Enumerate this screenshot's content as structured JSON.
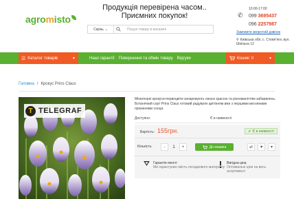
{
  "header": {
    "logo": {
      "part1": "agro",
      "part2": "m",
      "part3": "isto"
    },
    "slogan_line1": "Продукція перевірена часом..",
    "slogan_line2": "Приємних покупок!",
    "search": {
      "scope": "Скрізь",
      "placeholder": "Пошук товару в магазині"
    },
    "contacts": {
      "hours": "10:00-17:00",
      "phone1_prefix": "099",
      "phone1_number": "3695437",
      "phone2_prefix": "096",
      "phone2_number": "2257987",
      "callback": "Замовити зворотній дзвінок",
      "address_line1": "Київська обл, с. Стовпʼяги, вул.",
      "address_line2": "Шкільна 12"
    }
  },
  "nav": {
    "catalog_label": "Каталог товарів",
    "links": [
      "Наші гарантії",
      "Повернення та обмін товару",
      "Відгуки"
    ],
    "cart_label": "Кошик: 0"
  },
  "breadcrumb": {
    "home": "Головна",
    "separator": "/",
    "current": "Крокус Prins Claus"
  },
  "product": {
    "watermark": "TELEGRAF",
    "description": "Мініатюрні крокуси-первоцвіти зачаровують своєю красою та різноманіттям забарвлень. Ботанічний сорт Prins Claus готовий радувати цвітінням вже з першими весняними променями сонця.",
    "availability_label": "Доступно:",
    "availability_value": "Є в наявності",
    "price_label": "Вартість:",
    "price": "155грн.",
    "stock_badge": "Є в наявності",
    "qty_label": "Кількість:",
    "qty_value": "1",
    "buy_label": "До кошика",
    "features": [
      {
        "icon": "chevron-down-icon",
        "title": "Гарантія якості",
        "text": "Ми гарантуємо якість посадкового матеріалу"
      },
      {
        "icon": "exclamation-icon",
        "title": "Вигідна ціна",
        "text": "Оптимальні ціни на весь асортимент"
      }
    ]
  },
  "colors": {
    "green": "#5ab031",
    "orange": "#f05a24",
    "price": "#e8562a",
    "link": "#1e63b5"
  }
}
